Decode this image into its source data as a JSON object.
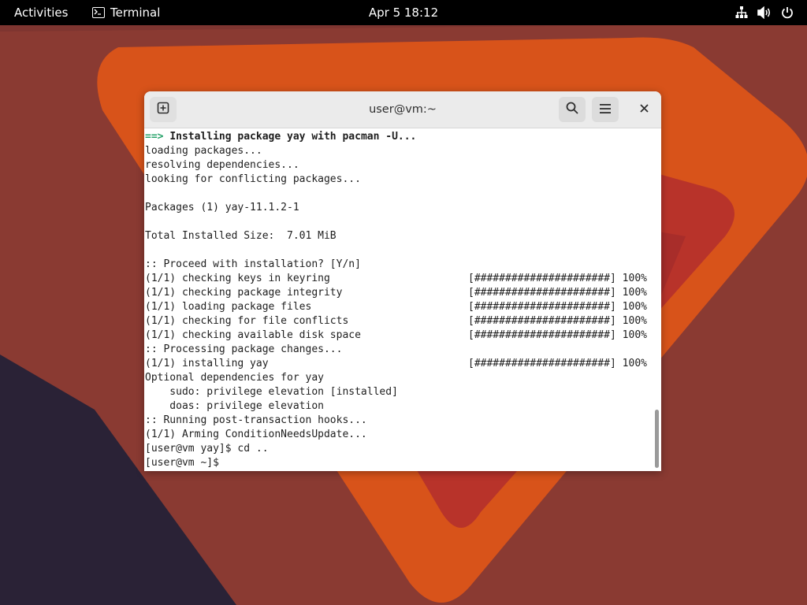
{
  "topbar": {
    "activities": "Activities",
    "app_name": "Terminal",
    "clock": "Apr 5  18:12",
    "tray_icons": [
      "network-icon",
      "volume-icon",
      "power-icon"
    ]
  },
  "window": {
    "title": "user@vm:~",
    "buttons": [
      "new-tab-icon",
      "search-icon",
      "hamburger-menu-icon",
      "close-icon"
    ]
  },
  "terminal": {
    "lines": [
      {
        "prefix": "==> ",
        "text": "Installing package yay with pacman -U...",
        "progress": ""
      },
      {
        "prefix": "",
        "text": "loading packages...",
        "progress": ""
      },
      {
        "prefix": "",
        "text": "resolving dependencies...",
        "progress": ""
      },
      {
        "prefix": "",
        "text": "looking for conflicting packages...",
        "progress": ""
      },
      {
        "prefix": "",
        "text": "",
        "progress": ""
      },
      {
        "prefix": "",
        "text": "Packages (1) yay-11.1.2-1",
        "progress": ""
      },
      {
        "prefix": "",
        "text": "",
        "progress": ""
      },
      {
        "prefix": "",
        "text": "Total Installed Size:  7.01 MiB",
        "progress": ""
      },
      {
        "prefix": "",
        "text": "",
        "progress": ""
      },
      {
        "prefix": "",
        "text": ":: Proceed with installation? [Y/n]",
        "progress": ""
      },
      {
        "prefix": "",
        "text": "(1/1) checking keys in keyring",
        "progress": "[######################] 100%"
      },
      {
        "prefix": "",
        "text": "(1/1) checking package integrity",
        "progress": "[######################] 100%"
      },
      {
        "prefix": "",
        "text": "(1/1) loading package files",
        "progress": "[######################] 100%"
      },
      {
        "prefix": "",
        "text": "(1/1) checking for file conflicts",
        "progress": "[######################] 100%"
      },
      {
        "prefix": "",
        "text": "(1/1) checking available disk space",
        "progress": "[######################] 100%"
      },
      {
        "prefix": "",
        "text": ":: Processing package changes...",
        "progress": ""
      },
      {
        "prefix": "",
        "text": "(1/1) installing yay",
        "progress": "[######################] 100%"
      },
      {
        "prefix": "",
        "text": "Optional dependencies for yay",
        "progress": ""
      },
      {
        "prefix": "",
        "text": "    sudo: privilege elevation [installed]",
        "progress": ""
      },
      {
        "prefix": "",
        "text": "    doas: privilege elevation",
        "progress": ""
      },
      {
        "prefix": "",
        "text": ":: Running post-transaction hooks...",
        "progress": ""
      },
      {
        "prefix": "",
        "text": "(1/1) Arming ConditionNeedsUpdate...",
        "progress": ""
      },
      {
        "prefix": "",
        "text": "[user@vm yay]$ cd ..",
        "progress": ""
      },
      {
        "prefix": "",
        "text": "[user@vm ~]$",
        "progress": ""
      }
    ],
    "prompt_color": "#26a269"
  },
  "colors": {
    "topbar": "#000000",
    "wallpaper_orange": "#e05a14",
    "wallpaper_red": "#b8302a",
    "wallpaper_dark": "#2a2236",
    "wallpaper_brown": "#7a3030"
  }
}
